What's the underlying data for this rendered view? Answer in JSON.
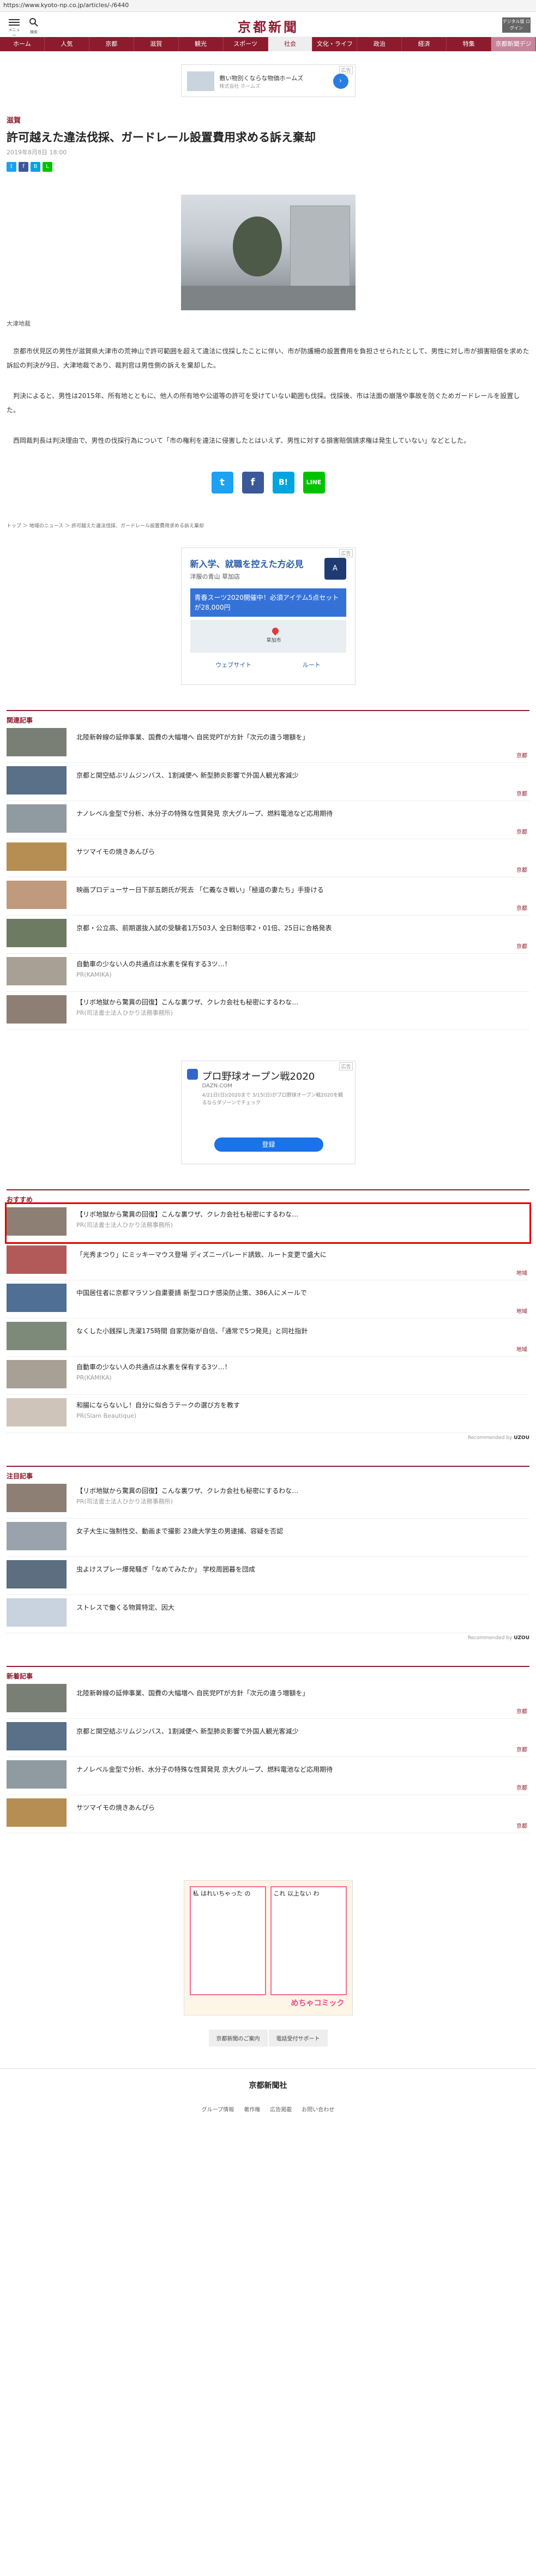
{
  "url": "https://www.kyoto-np.co.jp/articles/-/6440",
  "header": {
    "menu_label": "メニュー",
    "search_label": "検索",
    "logo": "京都新聞",
    "login_label": "デジタル版 ログイン"
  },
  "nav": [
    "ホーム",
    "人気",
    "京都",
    "滋賀",
    "観光",
    "スポーツ",
    "社会",
    "文化・ライフ",
    "政治",
    "経済",
    "特集",
    "京都新聞デジ"
  ],
  "ad1": {
    "tag": "広告",
    "text": "敷い物別くならな物価ホームズ",
    "sub": "株式会社 ホームズ"
  },
  "article": {
    "category": "滋賀",
    "title": "許可越えた違法伐採、ガードレール設置費用求める訴え棄却",
    "date": "2019年8月8日 18:00",
    "caption": "大津地裁",
    "paragraphs": [
      "京都市伏見区の男性が滋賀県大津市の荒神山で許可範囲を超えて違法に伐採したことに伴い、市が防護柵の設置費用を負担させられたとして、男性に対し市が損害賠償を求めた訴訟の判決が9日、大津地裁であり、裁判官は男性側の訴えを棄却した。",
      "判決によると、男性は2015年、所有地とともに、他人の所有地や公道等の許可を受けていない範囲も伐採。伐採後、市は法面の崩落や事故を防ぐためガードレールを設置した。",
      "西岡裁判長は判決理由で、男性の伐採行為について「市の権利を違法に侵害したとはいえず、男性に対する損害賠償請求権は発生していない」などとした。"
    ],
    "share": {
      "twitter": "t",
      "facebook": "f",
      "hatena": "B!",
      "line": "LINE"
    }
  },
  "breadcrumb": "トップ ＞ 地域のニュース ＞ 許可越えた違法伐採、ガードレール設置費用求める訴え棄却",
  "map_ad": {
    "tag": "広告",
    "title": "新入学、就職を控えた方必見",
    "sub": "洋服の青山 草加店",
    "offer": "青春スーツ2020開催中！必須アイテム5点セットが28,000円",
    "pin_label": "草加市",
    "website": "ウェブサイト",
    "route": "ルート"
  },
  "related": {
    "heading": "関連記事",
    "items": [
      {
        "text": "北陸新幹線の延伸事業、国費の大幅増へ 自民党PTが方針「次元の違う増額を」",
        "tag": "京都"
      },
      {
        "text": "京都と関空結ぶリムジンバス、1割減便へ 新型肺炎影響で外国人観光客減少",
        "tag": "京都"
      },
      {
        "text": "ナノレベル金型で分析、水分子の特殊な性質発見 京大グループ、燃料電池など応用期待",
        "tag": "京都"
      },
      {
        "text": "サツマイモの焼きあんぴら",
        "tag": "京都"
      },
      {
        "text": "映画プロデューサー日下部五朗氏が死去 「仁義なき戦い」「極道の妻たち」手掛ける",
        "tag": "京都"
      },
      {
        "text": "京都・公立高、前期選抜入試の受験者1万503人 全日制倍率2・01倍、25日に合格発表",
        "tag": "京都"
      },
      {
        "text": "自動車の少ない人の共通点は水素を保有する3ツ…！",
        "pr": "PR(KAMIKA)"
      },
      {
        "text": "【リボ地獄から驚異の回復】こんな裏ワザ、クレカ会社も秘密にするわな…",
        "pr": "PR(司法書士法人ひかり法務事務所)"
      }
    ]
  },
  "ad2": {
    "tag": "広告",
    "title": "プロ野球オープン戦2020",
    "sub": "DAZN.COM",
    "desc": "4/21日(日)/2020まで 3/15(日)がプロ野球オープン戦2020を観るならダゾーンでチェック",
    "btn": "登録"
  },
  "recommend": {
    "heading": "おすすめ",
    "items": [
      {
        "text": "【リボ地獄から驚異の回復】こんな裏ワザ、クレカ会社も秘密にするわな…",
        "pr": "PR(司法書士法人ひかり法務事務所)",
        "highlight": true
      },
      {
        "text": "「光秀まつり」にミッキーマウス登場 ディズニーパレード誘致、ルート変更で盛大に",
        "tag": "地域"
      },
      {
        "text": "中国居住者に京都マラソン自粛要請 新型コロナ感染防止策、386人にメールで",
        "tag": "地域"
      },
      {
        "text": "なくした小銭探し洗濯175時間 自家防衛が自信、「通常で5つ発見」と同社指針",
        "tag": "地域"
      },
      {
        "text": "自動車の少ない人の共通点は水素を保有する3ツ…！",
        "pr": "PR(KAMIKA)"
      },
      {
        "text": "和腸にならないし！自分に似合うテークの選び方を教す",
        "pr": "PR(Slam Beautique)"
      }
    ],
    "recommended_by": "Recommended by",
    "brand": "UZOU"
  },
  "attention": {
    "heading": "注目記事",
    "items": [
      {
        "text": "【リボ地獄から驚異の回復】こんな裏ワザ、クレカ会社も秘密にするわな…",
        "pr": "PR(司法書士法人ひかり法務事務所)"
      },
      {
        "text": "女子大生に強制性交、動画まで撮影 23歳大学生の男逮捕、容疑を否認"
      },
      {
        "text": "虫よけスプレー爆発騒ぎ「なめてみたか」 学校周囲暮を団成"
      },
      {
        "text": "ストレスで働くる物質特定、因大"
      }
    ],
    "recommended_by": "Recommended by",
    "brand": "UZOU"
  },
  "latest": {
    "heading": "新着記事",
    "items": [
      {
        "text": "北陸新幹線の延伸事業、国費の大幅増へ 自民党PTが方針「次元の違う増額を」",
        "tag": "京都"
      },
      {
        "text": "京都と関空結ぶリムジンバス、1割減便へ 新型肺炎影響で外国人観光客減少",
        "tag": "京都"
      },
      {
        "text": "ナノレベル金型で分析、水分子の特殊な性質発見 京大グループ、燃料電池など応用期待",
        "tag": "京都"
      },
      {
        "text": "サツマイモの焼きあんぴら",
        "tag": "京都"
      }
    ]
  },
  "cartoon": {
    "left_text": "私 はれいちゃった の",
    "right_text": "これ 以上ない わ",
    "brand": "めちゃコミック"
  },
  "footer": {
    "buttons": [
      "京都新聞のご案内",
      "電話受付サポート"
    ],
    "logo": "京都新聞社",
    "links": [
      "グループ情報",
      "著作権",
      "広告掲載",
      "お問い合わせ"
    ]
  }
}
